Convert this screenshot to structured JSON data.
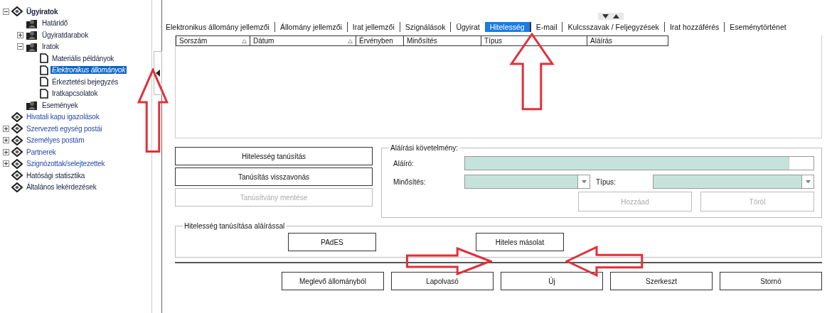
{
  "tree": [
    {
      "label": "Ügyiratok",
      "kind": "diamond",
      "link": false,
      "expanded": true,
      "selected": false,
      "children": [
        {
          "label": "Határidő",
          "kind": "case",
          "link": false,
          "selected": false
        },
        {
          "label": "Ügyiratdarabok",
          "kind": "case",
          "link": false,
          "expanded": false,
          "selected": false
        },
        {
          "label": "Iratok",
          "kind": "case",
          "link": false,
          "expanded": true,
          "selected": false,
          "children": [
            {
              "label": "Materiális példányok",
              "kind": "document",
              "link": false,
              "selected": false
            },
            {
              "label": "Elektronikus állományok",
              "kind": "document",
              "link": false,
              "selected": true
            },
            {
              "label": "Érkeztetési bejegyzés",
              "kind": "document",
              "link": false,
              "selected": false
            },
            {
              "label": "Iratkapcsolatok",
              "kind": "document",
              "link": false,
              "selected": false
            }
          ]
        },
        {
          "label": "Események",
          "kind": "case",
          "link": false,
          "selected": false
        }
      ]
    },
    {
      "label": "Hivatali kapu igazolások",
      "kind": "diamond",
      "link": true,
      "selected": false
    },
    {
      "label": "Szervezeti egység postái",
      "kind": "diamond",
      "link": true,
      "expanded": false,
      "selected": false
    },
    {
      "label": "Személyes postám",
      "kind": "diamond",
      "link": true,
      "expanded": false,
      "selected": false
    },
    {
      "label": "Partnerek",
      "kind": "diamond",
      "link": true,
      "expanded": false,
      "selected": false
    },
    {
      "label": "Szignózottak/selejtezettek",
      "kind": "diamond",
      "link": true,
      "expanded": false,
      "selected": false
    },
    {
      "label": "Hatósági statisztika",
      "kind": "diamond",
      "link": false,
      "selected": false
    },
    {
      "label": "Általános lekérdezések",
      "kind": "diamond",
      "link": false,
      "selected": false
    }
  ],
  "tabs": [
    {
      "label": "Elektronikus állomány jellemzői",
      "selected": false
    },
    {
      "label": "Állomány jellemzői",
      "selected": false
    },
    {
      "label": "Irat jellemzői",
      "selected": false
    },
    {
      "label": "Szignálások",
      "selected": false
    },
    {
      "label": "Ügyirat",
      "selected": false
    },
    {
      "label": "Hitelesség",
      "selected": true
    },
    {
      "label": "E-mail",
      "selected": false
    },
    {
      "label": "Kulcsszavak / Feljegyzések",
      "selected": false
    },
    {
      "label": "Irat hozzáférés",
      "selected": false
    },
    {
      "label": "Eseménytörténet",
      "selected": false
    }
  ],
  "table": {
    "columns": [
      {
        "label": "Sorszám",
        "sortable": true
      },
      {
        "label": "Dátum",
        "sortable": true
      },
      {
        "label": "Érvényben",
        "sortable": false
      },
      {
        "label": "Minősítés",
        "sortable": false
      },
      {
        "label": "Típus",
        "sortable": false
      },
      {
        "label": "Aláírás",
        "sortable": false
      }
    ]
  },
  "cert_buttons": [
    {
      "label": "Hitelesség tanúsítás",
      "disabled": false
    },
    {
      "label": "Tanúsítás visszavonás",
      "disabled": false
    },
    {
      "label": "Tanúsítvány mentése",
      "disabled": true
    }
  ],
  "signature_requirement": {
    "title": "Aláírási követelmény:",
    "signer_label": "Aláíró:",
    "rating_label": "Minősítés:",
    "type_label": "Típus:",
    "buttons": [
      {
        "label": "Hozzáad",
        "disabled": true
      },
      {
        "label": "Töröl",
        "disabled": true
      }
    ]
  },
  "signed_certification": {
    "title": "Hitelesség tanúsítása aláírással",
    "buttons": [
      {
        "label": "PAdES"
      },
      {
        "label": "Hiteles másolat"
      }
    ]
  },
  "bottom_buttons": [
    {
      "label": "Meglevő állományból"
    },
    {
      "label": "Lapolvasó"
    },
    {
      "label": "Új"
    },
    {
      "label": "Szerkeszt"
    },
    {
      "label": "Stornó"
    }
  ],
  "annotations": [
    {
      "kind": "up"
    },
    {
      "kind": "up"
    },
    {
      "kind": "right"
    },
    {
      "kind": "left"
    }
  ]
}
